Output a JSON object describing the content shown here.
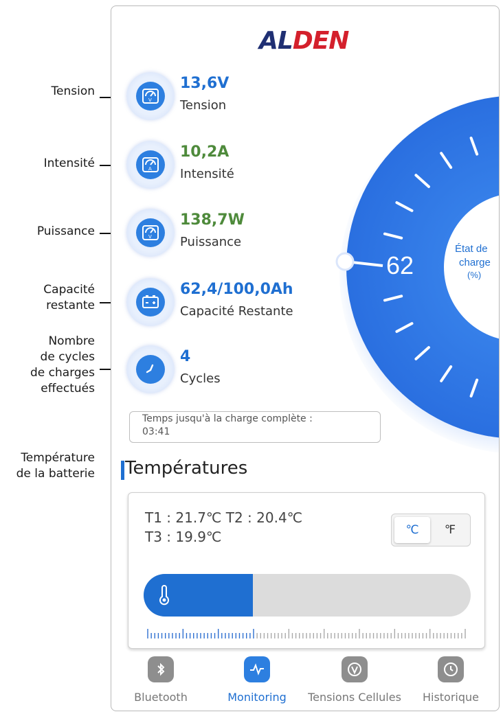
{
  "callouts": {
    "tension": "Tension",
    "intensite": "Intensité",
    "puissance": "Puissance",
    "capacite_l1": "Capacité",
    "capacite_l2": "restante",
    "cycles_l1": "Nombre",
    "cycles_l2": "de cycles",
    "cycles_l3": "de charges",
    "cycles_l4": "effectués",
    "temp_l1": "Température",
    "temp_l2": "de la batterie"
  },
  "brand": {
    "part1": "AL",
    "part2": "DEN",
    "colors": {
      "navy": "#1f2f73",
      "red": "#d4202c"
    }
  },
  "metrics": [
    {
      "value": "13,6V",
      "label": "Tension",
      "icon": "voltmeter-icon",
      "color": "#1f6fd1"
    },
    {
      "value": "10,2A",
      "label": "Intensité",
      "icon": "ammeter-icon",
      "color": "#4e8a3b"
    },
    {
      "value": "138,7W",
      "label": "Puissance",
      "icon": "wattmeter-icon",
      "color": "#4e8a3b"
    },
    {
      "value": "62,4/100,0Ah",
      "label": "Capacité Restante",
      "icon": "battery-icon",
      "color": "#1f6fd1"
    },
    {
      "value": "4",
      "label": "Cycles",
      "icon": "clock-icon",
      "color": "#1f6fd1"
    }
  ],
  "gauge": {
    "value": "62",
    "label_l1": "État de",
    "label_l2": "charge",
    "label_l3": "(%)"
  },
  "charge_time": {
    "label": "Temps jusqu'à la charge complète :",
    "value": "03:41"
  },
  "temperatures": {
    "heading": "Températures",
    "line1": "T1 :  21.7℃  T2 :  20.4℃",
    "line2": "T3 :  19.9℃",
    "unit_c": "℃",
    "unit_f": "℉",
    "selected_unit": "C",
    "bar_fill_fraction": 0.335,
    "icon": "thermometer-icon"
  },
  "nav": [
    {
      "label": "Bluetooth",
      "icon": "bluetooth-icon",
      "active": false
    },
    {
      "label": "Monitoring",
      "icon": "pulse-icon",
      "active": true
    },
    {
      "label": "Tensions Cellules",
      "icon": "voltage-cell-icon",
      "active": false
    },
    {
      "label": "Historique",
      "icon": "history-icon",
      "active": false
    }
  ],
  "colors": {
    "accent": "#1f6fd1",
    "green": "#4e8a3b",
    "gauge": "#2f7de6"
  }
}
